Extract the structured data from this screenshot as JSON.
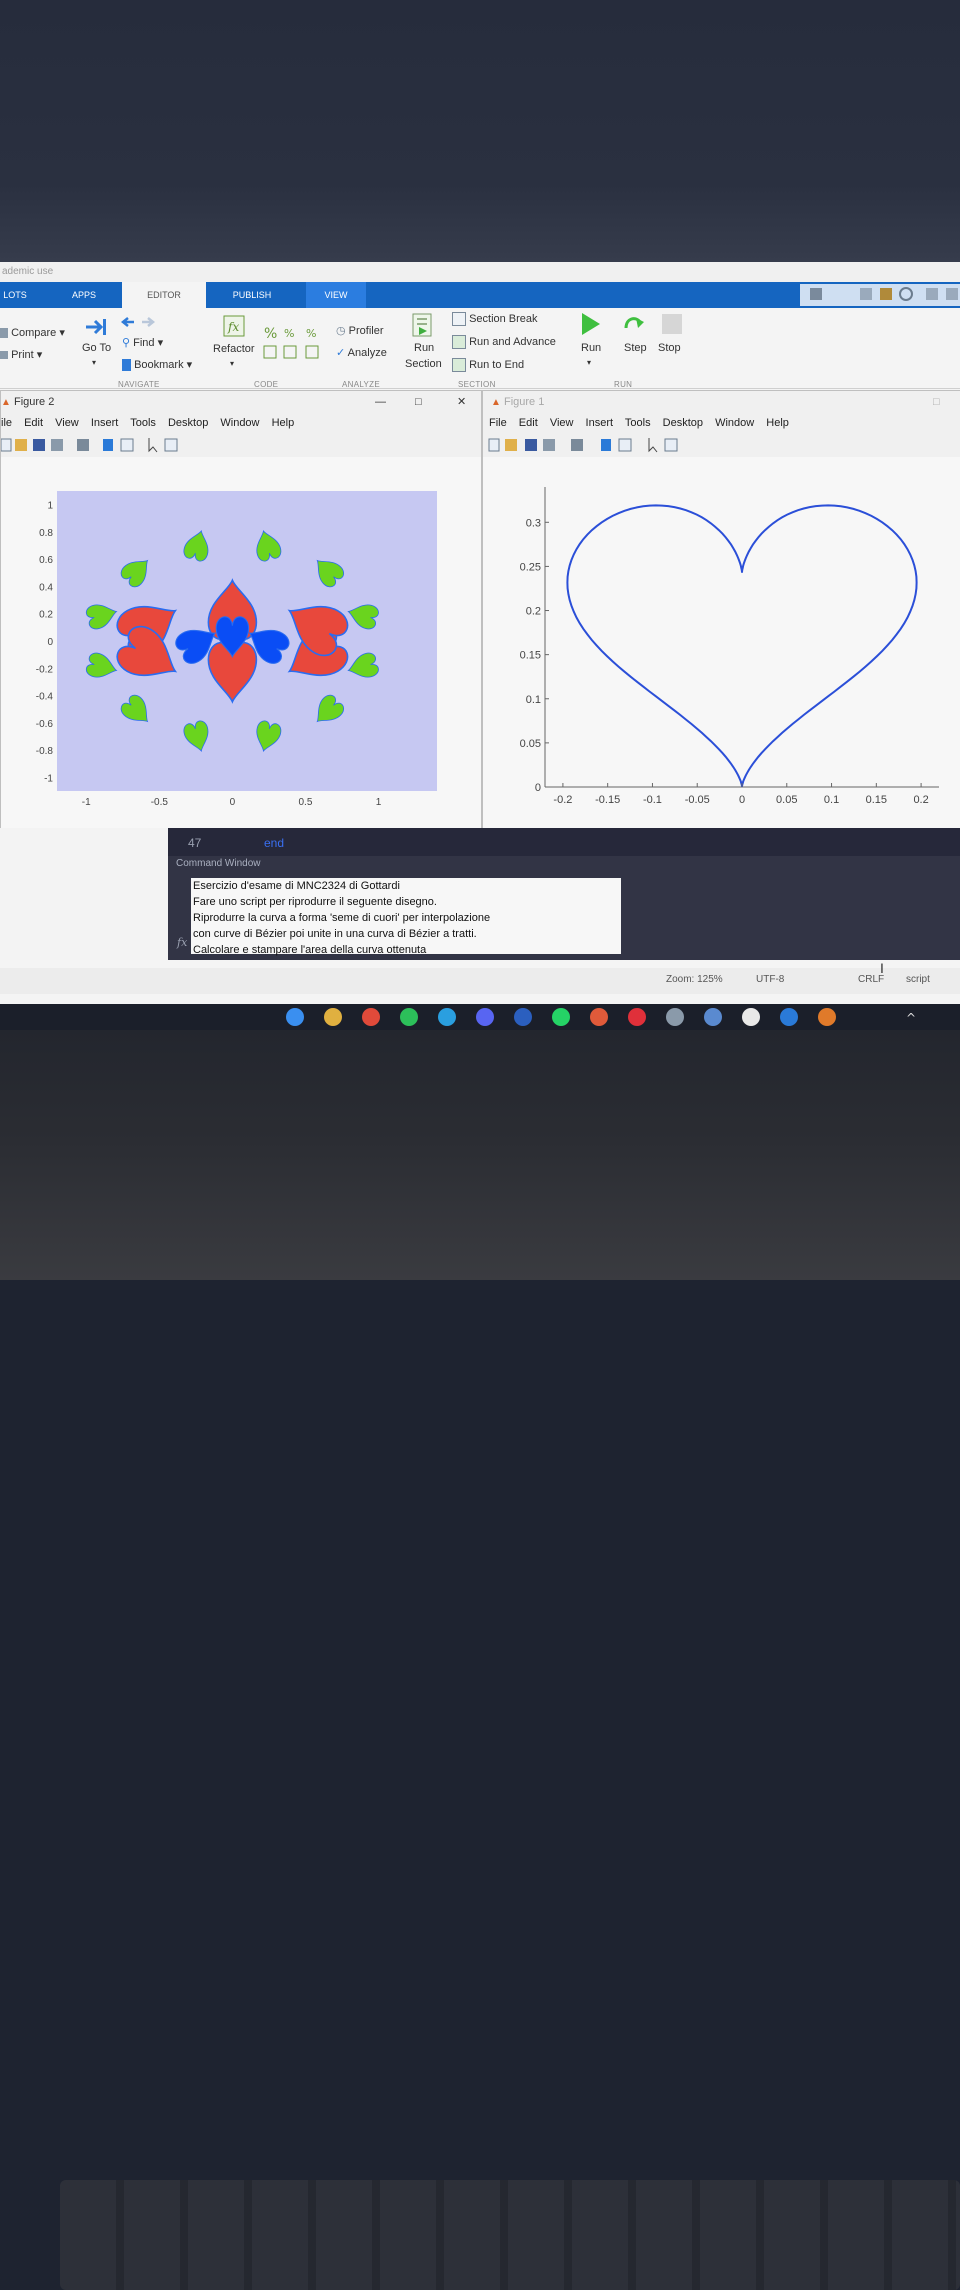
{
  "window": {
    "title_fragment": "ademic use"
  },
  "tabs": [
    {
      "label": "LOTS"
    },
    {
      "label": "APPS"
    },
    {
      "label": "EDITOR"
    },
    {
      "label": "PUBLISH"
    },
    {
      "label": "VIEW"
    }
  ],
  "ribbon": {
    "compare": "Compare",
    "print": "Print",
    "go_to": "Go To",
    "find": "Find",
    "bookmark": "Bookmark",
    "refactor": "Refactor",
    "profiler": "Profiler",
    "analyze": "Analyze",
    "run_section_1": "Run",
    "run_section_2": "Section",
    "section_break": "Section Break",
    "run_and_advance": "Run and Advance",
    "run_to_end": "Run to End",
    "run": "Run",
    "step": "Step",
    "stop": "Stop",
    "sections": {
      "navigate": "NAVIGATE",
      "code": "CODE",
      "analyze": "ANALYZE",
      "section": "SECTION",
      "run": "RUN"
    }
  },
  "figure2": {
    "title": "Figure 2",
    "menu": [
      "ile",
      "Edit",
      "View",
      "Insert",
      "Tools",
      "Desktop",
      "Window",
      "Help"
    ],
    "y_ticks": [
      "1",
      "0.8",
      "0.6",
      "0.4",
      "0.2",
      "0",
      "-0.2",
      "-0.4",
      "-0.6",
      "-0.8",
      "-1"
    ],
    "x_ticks": [
      "-1",
      "-0.5",
      "0",
      "0.5",
      "1"
    ],
    "colors": {
      "background": "#c6c8f2",
      "inner": "#0a4df5",
      "middle": "#e8483c",
      "outer": "#6ad41e",
      "edge": "#2a6cf0"
    }
  },
  "figure1": {
    "title": "Figure 1",
    "menu": [
      "File",
      "Edit",
      "View",
      "Insert",
      "Tools",
      "Desktop",
      "Window",
      "Help"
    ]
  },
  "chart_data": [
    {
      "type": "scatter",
      "title": "",
      "series": [
        {
          "color": "#0a4df5",
          "count": 3,
          "radius": 0.13
        },
        {
          "color": "#e8483c",
          "count": 6,
          "radius": 0.46
        },
        {
          "color": "#6ad41e",
          "count": 12,
          "radius": 0.85
        }
      ],
      "xlim": [
        -1.2,
        1.4
      ],
      "ylim": [
        -1.1,
        1.1
      ],
      "grid": false
    },
    {
      "type": "line",
      "title": "",
      "x_ticks": [
        -0.2,
        -0.15,
        -0.1,
        -0.05,
        0,
        0.05,
        0.1,
        0.15,
        0.2
      ],
      "y_ticks": [
        0,
        0.05,
        0.1,
        0.15,
        0.2,
        0.25,
        0.3
      ],
      "x_tick_labels": [
        "-0.2",
        "-0.15",
        "-0.1",
        "-0.05",
        "0",
        "0.05",
        "0.1",
        "0.15",
        "0.2"
      ],
      "y_tick_labels": [
        "0",
        "0.05",
        "0.1",
        "0.15",
        "0.2",
        "0.25",
        "0.3"
      ],
      "xlim": [
        -0.22,
        0.22
      ],
      "ylim": [
        0,
        0.34
      ],
      "grid": false,
      "line_color": "#2b4fd8"
    }
  ],
  "editor": {
    "line_number": "47",
    "keyword": "end"
  },
  "command_window": {
    "title": "Command Window",
    "lines": [
      "Esercizio d'esame di MNC2324 di Gottardi",
      "Fare uno script per riprodurre il seguente disegno.",
      "Riprodurre la curva a forma 'seme di cuori' per interpolazione",
      "con curve di Bézier poi unite in una curva di Bézier a tratti.",
      "Calcolare e stampare l'area della curva ottenuta"
    ],
    "prompt": "fx"
  },
  "status": {
    "zoom": "Zoom: 125%",
    "encoding": "UTF-8",
    "eol": "CRLF",
    "type": "script"
  },
  "taskbar": {
    "icons": [
      "windows-icon",
      "file-explorer-icon",
      "chrome-icon",
      "spotify-icon",
      "telegram-icon",
      "discord-icon",
      "word-icon",
      "whatsapp-icon",
      "app-icon",
      "opera-icon",
      "app-icon",
      "app-icon",
      "notion-icon",
      "vscode-icon",
      "matlab-icon"
    ]
  }
}
